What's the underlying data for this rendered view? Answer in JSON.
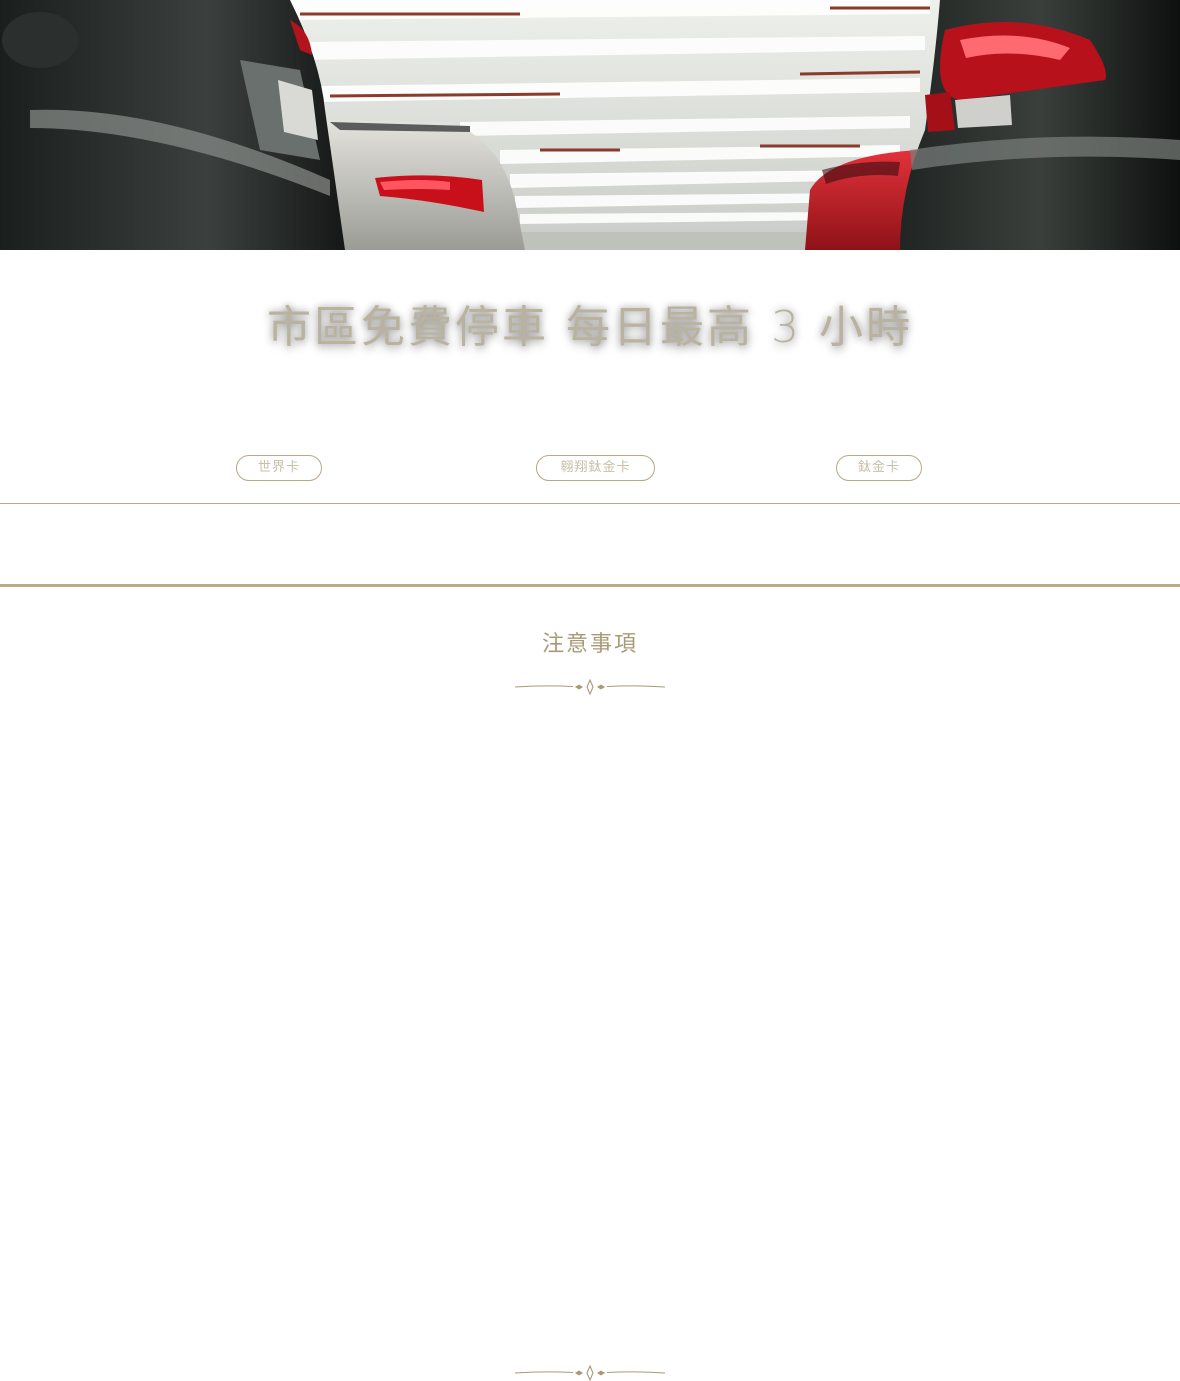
{
  "hero": {
    "image": "parking-garage-photo"
  },
  "headline": "市區免費停車 每日最高 3 小時",
  "tabs": [
    {
      "label": "世界卡"
    },
    {
      "label": "翱翔鈦金卡"
    },
    {
      "label": "鈦金卡"
    }
  ],
  "notes": {
    "title": "注意事項"
  },
  "colors": {
    "accent": "#b7a887",
    "title_text": "#a99a76",
    "headline_text": "#b9b29f",
    "background": "#ffffff"
  },
  "icons": {
    "divider": "ornament-divider-icon"
  }
}
